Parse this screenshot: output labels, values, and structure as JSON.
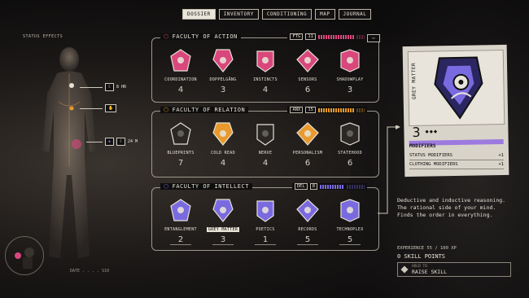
{
  "tabs": [
    "DOSSIER",
    "INVENTORY",
    "CONDITIONING",
    "MAP",
    "JOURNAL"
  ],
  "left": {
    "status_label": "STATUS EFFECTS",
    "markers": [
      {
        "icon": "moon-icon",
        "text": "8 HR"
      },
      {
        "icon": "hand-icon",
        "text": ""
      },
      {
        "icon": "moon-icon",
        "text": "24 M"
      }
    ],
    "date_label": "DATE . . . . S10"
  },
  "sections": [
    {
      "title": "FACULTY OF ACTION",
      "stat_code": "FTG",
      "stat_value": "11",
      "color": "#d9477c",
      "cards": [
        {
          "name": "COORDINATION",
          "value": "4"
        },
        {
          "name": "DOPPELGÄNG",
          "value": "3"
        },
        {
          "name": "INSTINCTS",
          "value": "4"
        },
        {
          "name": "SENSORS",
          "value": "6"
        },
        {
          "name": "SHADOWPLAY",
          "value": "3"
        }
      ]
    },
    {
      "title": "FACULTY OF RELATION",
      "stat_code": "ANX",
      "stat_value": "15",
      "color": "#e99a2c",
      "cards": [
        {
          "name": "BLUEPRINTS",
          "value": "7"
        },
        {
          "name": "COLD READ",
          "value": "4"
        },
        {
          "name": "NERVE",
          "value": "4"
        },
        {
          "name": "PERSONALISM",
          "value": "6"
        },
        {
          "name": "STATEHOOD",
          "value": "6"
        }
      ]
    },
    {
      "title": "FACULTY OF INTELLECT",
      "stat_code": "DEL",
      "stat_value": "8",
      "color": "#7a6ae0",
      "cards": [
        {
          "name": "ENTANGLEMENT",
          "value": "2"
        },
        {
          "name": "GREY MATTER",
          "value": "3"
        },
        {
          "name": "POETICS",
          "value": "1"
        },
        {
          "name": "RECORDS",
          "value": "5"
        },
        {
          "name": "TECHNOPLEX",
          "value": "5"
        }
      ]
    }
  ],
  "detail": {
    "card_label": "GREY MATTER",
    "rank": "3",
    "suits": "◆◆◆",
    "modifiers_title": "MODIFIERS",
    "modifiers": [
      {
        "label": "STATUS MODIFIERS",
        "value": "+1"
      },
      {
        "label": "CLOTHING MODIFIERS",
        "value": "+1"
      }
    ],
    "description": "Deductive and inductive reasoning. The rational side of your mind. Finds the order in everything.",
    "experience": "EXPERIENCE 55 / 100 XP",
    "skill_points": "0 SKILL POINTS",
    "hold_hint": "HOLD TO",
    "hold_action": "RAISE SKILL"
  }
}
